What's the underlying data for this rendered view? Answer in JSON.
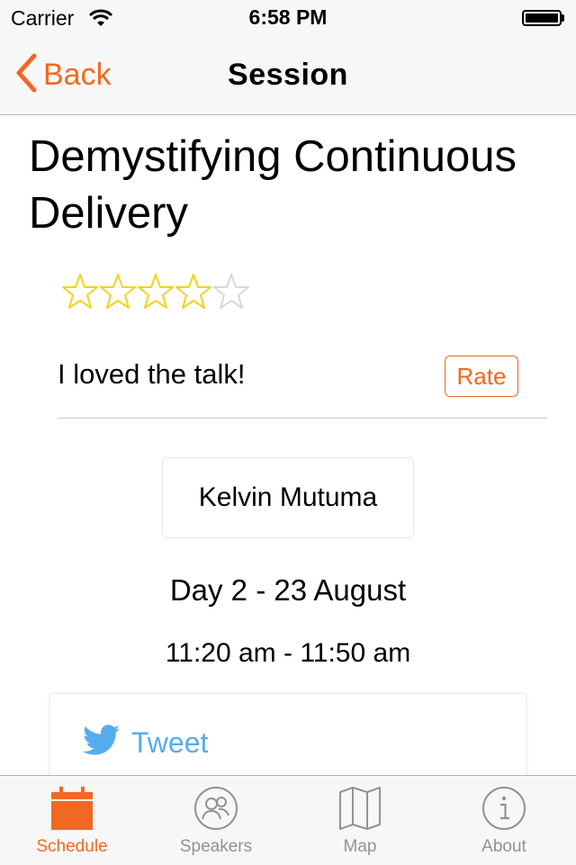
{
  "status_bar": {
    "carrier": "Carrier",
    "time": "6:58 PM",
    "battery_level": 1.0
  },
  "nav": {
    "back_label": "Back",
    "title": "Session"
  },
  "session": {
    "title": "Demystifying Continuous Delivery",
    "rating": 4,
    "rating_max": 5,
    "feedback": "I loved the talk!",
    "rate_label": "Rate",
    "speaker": "Kelvin Mutuma",
    "day": "Day 2 - 23 August",
    "time": "11:20 am - 11:50 am",
    "tweet_label": "Tweet"
  },
  "tabs": [
    {
      "label": "Schedule",
      "icon": "calendar-icon",
      "active": true
    },
    {
      "label": "Speakers",
      "icon": "people-icon",
      "active": false
    },
    {
      "label": "Map",
      "icon": "map-icon",
      "active": false
    },
    {
      "label": "About",
      "icon": "info-icon",
      "active": false
    }
  ],
  "colors": {
    "accent": "#f26722",
    "star_filled": "#f5d21a",
    "star_empty": "#d8d8d8",
    "twitter": "#55acee",
    "tab_inactive": "#929292"
  }
}
